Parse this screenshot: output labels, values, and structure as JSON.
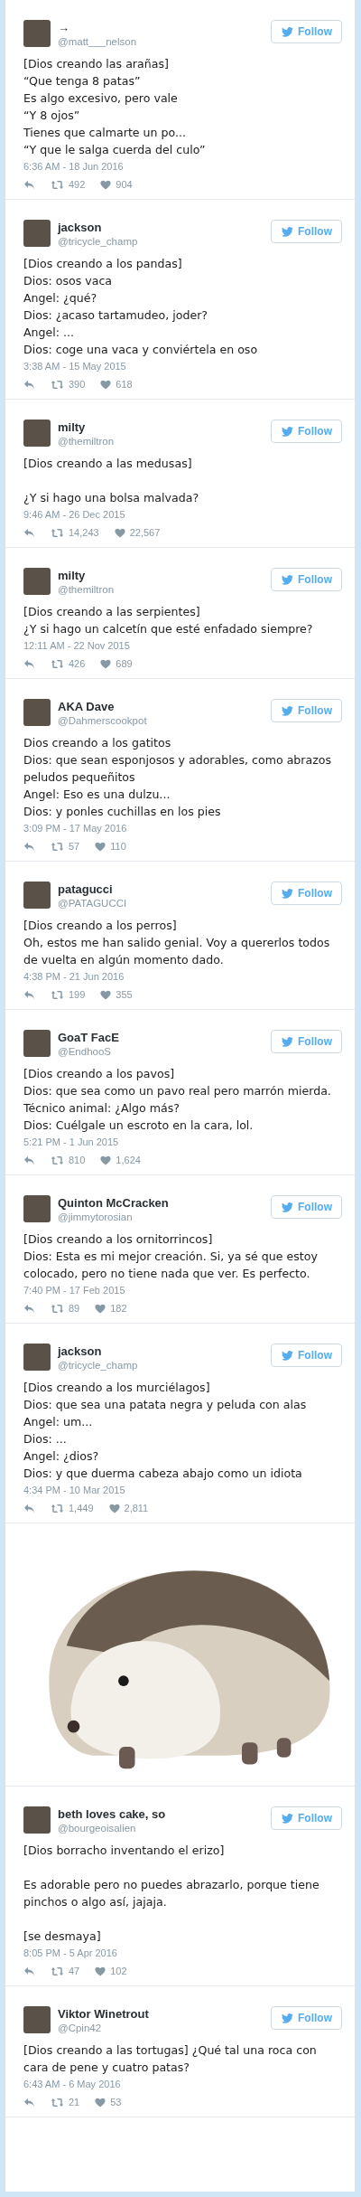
{
  "tweets": [
    {
      "kind": "tweet",
      "name": "→",
      "handle": "@matt___nelson",
      "follow": "Follow",
      "text": "[Dios creando las arañas]\n“Que tenga 8 patas”\nEs algo excesivo, pero vale\n“Y 8 ojos”\nTienes que calmarte un po...\n“Y que le salga cuerda del culo”",
      "time": "6:36 AM - 18 Jun 2016",
      "retweets": "492",
      "likes": "904"
    },
    {
      "kind": "tweet",
      "name": "jackson",
      "handle": "@tricycle_champ",
      "follow": "Follow",
      "text": "[Dios creando a los pandas]\nDios: osos vaca\nAngel: ¿qué?\nDios: ¿acaso tartamudeo, joder?\nAngel: ...\nDios: coge una vaca y conviértela en oso",
      "time": "3:38 AM - 15 May 2015",
      "retweets": "390",
      "likes": "618"
    },
    {
      "kind": "tweet",
      "name": "milty",
      "handle": "@themiltron",
      "follow": "Follow",
      "text": "[Dios creando a las medusas]\n\n¿Y si hago una bolsa malvada?",
      "time": "9:46 AM - 26 Dec 2015",
      "retweets": "14,243",
      "likes": "22,567"
    },
    {
      "kind": "tweet",
      "name": "milty",
      "handle": "@themiltron",
      "follow": "Follow",
      "text": "[Dios creando a las serpientes]\n¿Y si hago un calcetín que esté enfadado siempre?",
      "time": "12:11 AM - 22 Nov 2015",
      "retweets": "426",
      "likes": "689"
    },
    {
      "kind": "tweet",
      "name": "AKA Dave",
      "handle": "@Dahmerscookpot",
      "follow": "Follow",
      "text": "Dios creando a los gatitos\nDios: que sean esponjosos y adorables, como abrazos peludos pequeñitos\nAngel: Eso es una dulzu...\nDios: y ponles cuchillas en los pies",
      "time": "3:09 PM - 17 May 2016",
      "retweets": "57",
      "likes": "110"
    },
    {
      "kind": "tweet",
      "name": "patagucci",
      "handle": "@PATAGUCCI",
      "follow": "Follow",
      "text": "[Dios creando a los perros]\nOh, estos me han salido genial. Voy a quererlos todos de vuelta en algún momento dado.",
      "time": "4:38 PM - 21 Jun 2016",
      "retweets": "199",
      "likes": "355"
    },
    {
      "kind": "tweet",
      "name": "GoaT FacE",
      "handle": "@EndhooS",
      "follow": "Follow",
      "text": "[Dios creando a los pavos]\nDios: que sea como un pavo real pero marrón mierda.\nTécnico animal: ¿Algo más?\nDios: Cuélgale un escroto en la cara, lol.",
      "time": "5:21 PM - 1 Jun 2015",
      "retweets": "810",
      "likes": "1,624"
    },
    {
      "kind": "tweet",
      "name": "Quinton McCracken",
      "handle": "@jimmytorosian",
      "follow": "Follow",
      "text": "[Dios creando a los ornitorrincos]\nDios: Esta es mi mejor creación. Si, ya sé que estoy colocado, pero no tiene nada que ver. Es perfecto.",
      "time": "7:40 PM - 17 Feb 2015",
      "retweets": "89",
      "likes": "182"
    },
    {
      "kind": "tweet",
      "name": "jackson",
      "handle": "@tricycle_champ",
      "follow": "Follow",
      "text": "[Dios creando a los murciélagos]\nDios: que sea una patata negra y peluda con alas\nAngel: um...\nDios: ...\nAngel: ¿dios?\nDios: y que duerma cabeza abajo como un idiota",
      "time": "4:34 PM - 10 Mar 2015",
      "retweets": "1,449",
      "likes": "2,811"
    },
    {
      "kind": "photo"
    },
    {
      "kind": "tweet",
      "name": "beth loves cake, so",
      "handle": "@bourgeoisalien",
      "follow": "Follow",
      "text": "[Dios borracho inventando el erizo]\n\nEs adorable pero no puedes abrazarlo, porque tiene pinchos o algo así, jajaja.\n\n[se desmaya]",
      "time": "8:05 PM - 5 Apr 2016",
      "retweets": "47",
      "likes": "102"
    },
    {
      "kind": "tweet",
      "name": "Viktor Winetrout",
      "handle": "@Cpin42",
      "follow": "Follow",
      "text": "[Dios creando a las tortugas] ¿Qué tal una roca con cara de pene y cuatro patas?",
      "time": "6:43 AM - 6 May 2016",
      "retweets": "21",
      "likes": "53"
    }
  ]
}
